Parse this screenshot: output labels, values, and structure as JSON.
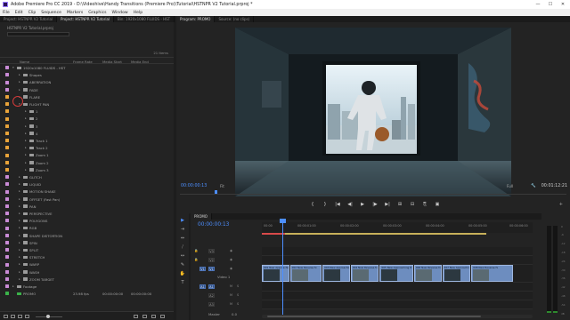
{
  "window": {
    "title": "Adobe Premiere Pro CC 2019 - D:\\Videohive\\Handy Transitions (Premiere Pro)\\Tutorial\\HSTNPR V2 Tutorial.prproj *",
    "controls": [
      "—",
      "☐",
      "✕"
    ]
  },
  "menu": [
    "File",
    "Edit",
    "Clip",
    "Sequence",
    "Markers",
    "Graphics",
    "Window",
    "Help"
  ],
  "project_panel": {
    "tabs": [
      "Project: HSTNPR V2 Tutorial",
      "Project: HSTNPR V2 Tutorial",
      "Bin: 1920x1080 FLUIDS - HST"
    ],
    "path": "HSTNPR V2 Tutorial.prproj",
    "items_count": "21 Items",
    "columns": {
      "name": "Name",
      "frame_rate": "Frame Rate",
      "media_start": "Media Start",
      "media_end": "Media End"
    },
    "rows": [
      {
        "name": "1920x1080 FLUIDS - HST",
        "color": "#c98bd6",
        "level": 0,
        "twisty": "▾"
      },
      {
        "name": "Shapes",
        "color": "#c98bd6",
        "level": 1,
        "twisty": "▸"
      },
      {
        "name": "ABERRATION",
        "color": "#c98bd6",
        "level": 1,
        "twisty": "▸"
      },
      {
        "name": "FADE",
        "color": "#c98bd6",
        "level": 1,
        "twisty": "▸"
      },
      {
        "name": "FLARE",
        "color": "#e8a33a",
        "level": 1,
        "twisty": "▸"
      },
      {
        "name": "FLIGHT PAN",
        "color": "#e8a33a",
        "level": 1,
        "twisty": "▾"
      },
      {
        "name": "1",
        "color": "#e8a33a",
        "level": 2,
        "twisty": "▸"
      },
      {
        "name": "2",
        "color": "#e8a33a",
        "level": 2,
        "twisty": "▸"
      },
      {
        "name": "3",
        "color": "#e8a33a",
        "level": 2,
        "twisty": "▸"
      },
      {
        "name": "4",
        "color": "#e8a33a",
        "level": 2,
        "twisty": "▸"
      },
      {
        "name": "Track 1",
        "color": "#e8a33a",
        "level": 2,
        "twisty": "▸"
      },
      {
        "name": "Track 2",
        "color": "#e8a33a",
        "level": 2,
        "twisty": "▸"
      },
      {
        "name": "Zoom 1",
        "color": "#e8a33a",
        "level": 2,
        "twisty": "▸"
      },
      {
        "name": "Zoom 2",
        "color": "#e8a33a",
        "level": 2,
        "twisty": "▸"
      },
      {
        "name": "Zoom 3",
        "color": "#e8a33a",
        "level": 2,
        "twisty": "▸"
      },
      {
        "name": "GLITCH",
        "color": "#c98bd6",
        "level": 1,
        "twisty": "▸"
      },
      {
        "name": "LIQUID",
        "color": "#c98bd6",
        "level": 1,
        "twisty": "▸"
      },
      {
        "name": "MOTION SHAKE",
        "color": "#c98bd6",
        "level": 1,
        "twisty": "▸"
      },
      {
        "name": "OFFSET (Fast Pan)",
        "color": "#c98bd6",
        "level": 1,
        "twisty": "▸"
      },
      {
        "name": "PAN",
        "color": "#c98bd6",
        "level": 1,
        "twisty": "▸"
      },
      {
        "name": "PERSPECTIVE",
        "color": "#c98bd6",
        "level": 1,
        "twisty": "▸"
      },
      {
        "name": "POLYGONS",
        "color": "#c98bd6",
        "level": 1,
        "twisty": "▸"
      },
      {
        "name": "RGB",
        "color": "#c98bd6",
        "level": 1,
        "twisty": "▸"
      },
      {
        "name": "SHAPE DISTORTION",
        "color": "#c98bd6",
        "level": 1,
        "twisty": "▸"
      },
      {
        "name": "SPIN",
        "color": "#c98bd6",
        "level": 1,
        "twisty": "▸"
      },
      {
        "name": "SPLIT",
        "color": "#c98bd6",
        "level": 1,
        "twisty": "▸"
      },
      {
        "name": "STRETCH",
        "color": "#c98bd6",
        "level": 1,
        "twisty": "▸"
      },
      {
        "name": "WARP",
        "color": "#c98bd6",
        "level": 1,
        "twisty": "▸"
      },
      {
        "name": "WASH",
        "color": "#c98bd6",
        "level": 1,
        "twisty": "▸"
      },
      {
        "name": "ZOOM TARGET",
        "color": "#c98bd6",
        "level": 1,
        "twisty": "▸"
      },
      {
        "name": "Footage",
        "color": "#c98bd6",
        "level": 0,
        "twisty": "▸"
      },
      {
        "name": "PROMO",
        "color": "#3bb34a",
        "level": 0,
        "twisty": "",
        "frame_rate": "23.98 fps",
        "media_start": "00:00:00:00",
        "media_end": "00:00:00:00",
        "sequence": true
      }
    ]
  },
  "program_monitor": {
    "tabs": [
      "Program: PROMO",
      "Source: (no clips)"
    ],
    "timecode": "00:00:00:13",
    "fit": "Fit",
    "resolution": "Full",
    "duration": "00:01:12:21",
    "transport": [
      "{",
      "}",
      "|◀",
      "◀|",
      "▶",
      "|▶",
      "▶|",
      "⊞",
      "⊟",
      "⎘",
      "▣",
      "+"
    ]
  },
  "tools": [
    "▶",
    "⇥",
    "⇔",
    "⧸",
    "↔",
    "✎",
    "✋",
    "T"
  ],
  "timeline": {
    "sequence_name": "PROMO",
    "timecode": "00:00:00:13",
    "ruler_ticks": [
      "00:00",
      "00:00:01:00",
      "00:00:02:00",
      "00:00:03:00",
      "00:00:04:00",
      "00:00:05:00",
      "00:00:06:00"
    ],
    "tracks": [
      {
        "id": "V3",
        "kind": "video"
      },
      {
        "id": "V2",
        "kind": "video"
      },
      {
        "id": "V1",
        "kind": "video",
        "label": "Video 1"
      },
      {
        "id": "A1",
        "kind": "audio"
      },
      {
        "id": "A2",
        "kind": "audio"
      },
      {
        "id": "A3",
        "kind": "audio"
      }
    ],
    "master": {
      "label": "Master",
      "value": "0.0"
    },
    "clips": [
      {
        "label": "001 New Approaching 8 fx",
        "start": 0.0,
        "end": 0.66
      },
      {
        "label": "002 New Reverse fx",
        "start": 0.66,
        "end": 1.42
      },
      {
        "label": "003 New Approaching 8 fx",
        "start": 1.42,
        "end": 2.08
      },
      {
        "label": "004 New Reverse fx",
        "start": 2.08,
        "end": 2.76
      },
      {
        "label": "005 New Approaching 8 fx",
        "start": 2.76,
        "end": 3.56
      },
      {
        "label": "006 New Reverse fx",
        "start": 3.56,
        "end": 4.22
      },
      {
        "label": "007 New Approaching 8 fx",
        "start": 4.22,
        "end": 4.9
      },
      {
        "label": "008 New Reverse fx",
        "start": 4.9,
        "end": 5.9
      }
    ]
  },
  "audio_meter": {
    "scale": [
      "0",
      "-6",
      "-12",
      "-18",
      "-24",
      "-30",
      "-36",
      "-42",
      "-48",
      "-54",
      "dB"
    ],
    "level_left": 0.02,
    "level_right": 0.02
  }
}
